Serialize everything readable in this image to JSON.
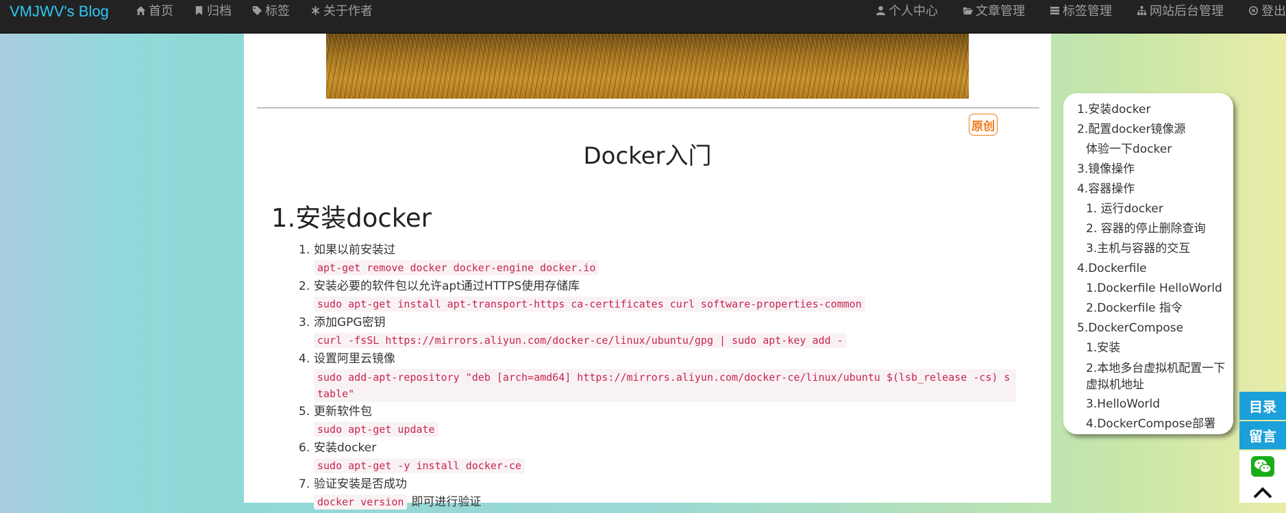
{
  "navbar": {
    "brand": "VMJWV's Blog",
    "left": [
      {
        "label": "首页",
        "icon": "home-icon"
      },
      {
        "label": "归档",
        "icon": "bookmark-icon"
      },
      {
        "label": "标签",
        "icon": "tag-icon"
      },
      {
        "label": "关于作者",
        "icon": "asterisk-icon"
      }
    ],
    "right": [
      {
        "label": "个人中心",
        "icon": "user-icon"
      },
      {
        "label": "文章管理",
        "icon": "folder-open-icon"
      },
      {
        "label": "标签管理",
        "icon": "list-icon"
      },
      {
        "label": "网站后台管理",
        "icon": "sitemap-icon"
      },
      {
        "label": "登出",
        "icon": "logout-icon"
      }
    ]
  },
  "article": {
    "badge": "原创",
    "title": "Docker入门",
    "heading": "1.安装docker",
    "steps": [
      {
        "num": "1.",
        "text": "如果以前安装过",
        "code": "apt-get remove docker docker-engine docker.io",
        "after": ""
      },
      {
        "num": "2.",
        "text": "安装必要的软件包以允许apt通过HTTPS使用存储库",
        "code": "sudo apt-get install apt-transport-https ca-certificates curl software-properties-common",
        "after": ""
      },
      {
        "num": "3.",
        "text": "添加GPG密钥",
        "code": "curl -fsSL https://mirrors.aliyun.com/docker-ce/linux/ubuntu/gpg | sudo apt-key add -",
        "after": ""
      },
      {
        "num": "4.",
        "text": "设置阿里云镜像",
        "code": "sudo add-apt-repository \"deb [arch=amd64] https://mirrors.aliyun.com/docker-ce/linux/ubuntu $(lsb_release -cs) stable\"",
        "after": ""
      },
      {
        "num": "5.",
        "text": "更新软件包",
        "code": "sudo apt-get update",
        "after": ""
      },
      {
        "num": "6.",
        "text": "安装docker",
        "code": "sudo apt-get -y install docker-ce",
        "after": ""
      },
      {
        "num": "7.",
        "text": "验证安装是否成功",
        "code": "docker version",
        "after": "即可进行验证"
      }
    ]
  },
  "toc": {
    "items": [
      {
        "label": "1.安装docker",
        "level": 1
      },
      {
        "label": "2.配置docker镜像源",
        "level": 1
      },
      {
        "label": "体验一下docker",
        "level": 2
      },
      {
        "label": "3.镜像操作",
        "level": 1
      },
      {
        "label": "4.容器操作",
        "level": 1
      },
      {
        "label": "1. 运行docker",
        "level": 2
      },
      {
        "label": "2. 容器的停止删除查询",
        "level": 2
      },
      {
        "label": "3.主机与容器的交互",
        "level": 2
      },
      {
        "label": "4.Dockerfile",
        "level": 1
      },
      {
        "label": "1.Dockerfile HelloWorld",
        "level": 2
      },
      {
        "label": "2.Dockerfile 指令",
        "level": 2
      },
      {
        "label": "5.DockerCompose",
        "level": 1
      },
      {
        "label": "1.安装",
        "level": 2
      },
      {
        "label": "2.本地多台虚拟机配置一下虚拟机地址",
        "level": 2
      },
      {
        "label": "3.HelloWorld",
        "level": 2
      },
      {
        "label": "4.DockerCompose部署",
        "level": 2
      }
    ]
  },
  "side": {
    "toc_button": "目录",
    "comment_button": "留言",
    "wechat_icon": "wechat-icon",
    "top_icon": "chevron-up-icon"
  },
  "colors": {
    "nav_bg": "#222222",
    "brand": "#2fc8f3",
    "code_text": "#c7254e",
    "code_bg": "#f9f2f4",
    "badge": "#f07a1a",
    "side_button": "#1ca0d9",
    "wechat": "#1aad19"
  }
}
